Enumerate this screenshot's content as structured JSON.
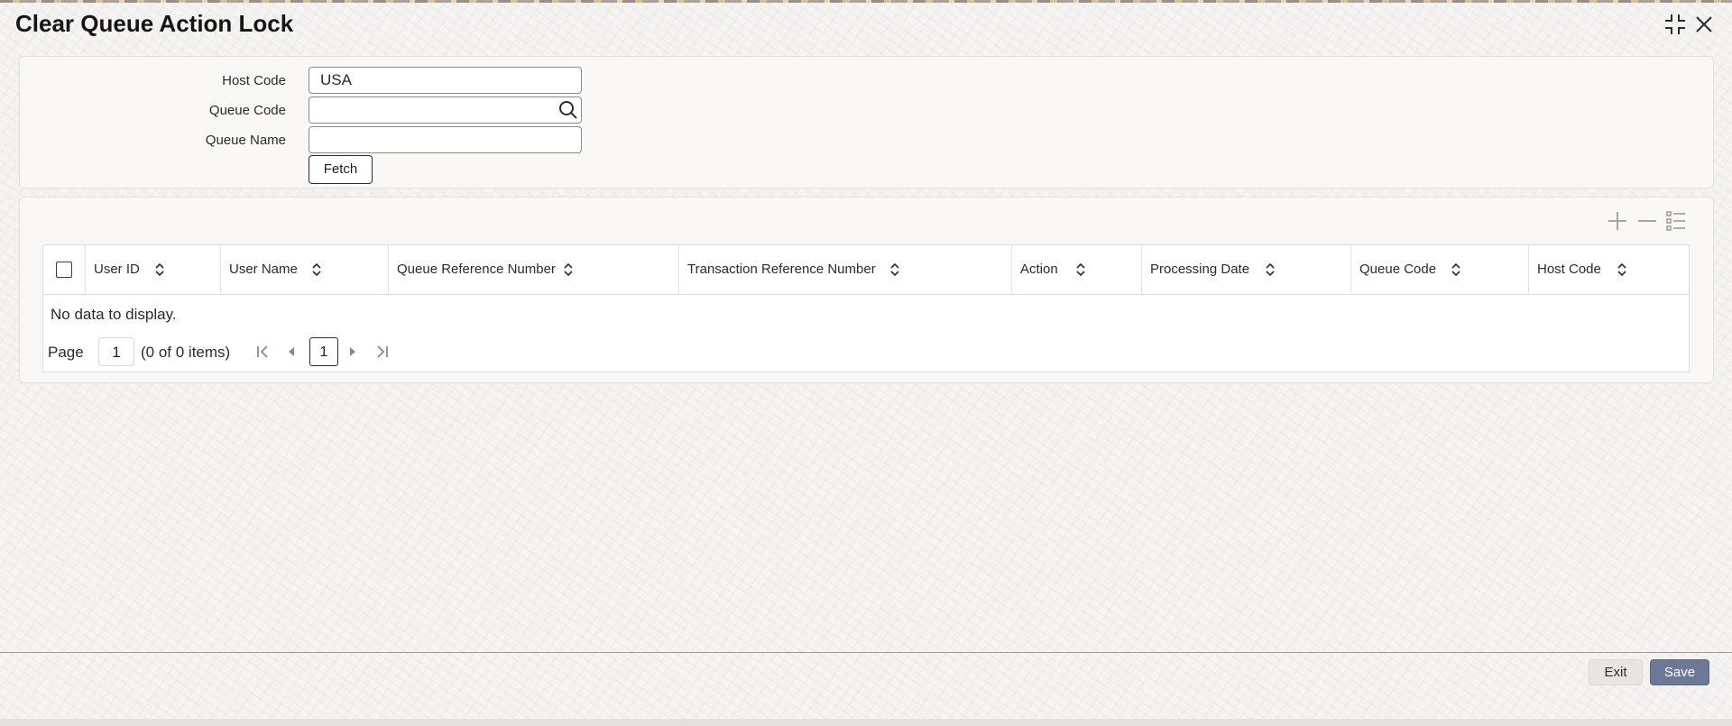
{
  "window": {
    "title": "Clear Queue Action Lock",
    "minimize_icon": "collapse-icon",
    "close_icon": "close-icon"
  },
  "search_form": {
    "host_code": {
      "label": "Host Code",
      "value": "USA"
    },
    "queue_code": {
      "label": "Queue Code",
      "value": "",
      "icon": "search-icon"
    },
    "queue_name": {
      "label": "Queue Name",
      "value": ""
    },
    "fetch_label": "Fetch"
  },
  "grid": {
    "toolbar_icons": [
      "plus-icon",
      "minus-icon",
      "list-icon"
    ],
    "columns": [
      "User ID",
      "User Name",
      "Queue Reference Number",
      "Transaction Reference Number",
      "Action",
      "Processing Date",
      "Queue Code",
      "Host Code"
    ],
    "empty_message": "No data to display.",
    "pagination": {
      "page_label": "Page",
      "page_value": "1",
      "items_summary": "(0 of 0 items)",
      "current_page": "1"
    }
  },
  "footer": {
    "exit_label": "Exit",
    "save_label": "Save"
  },
  "colors": {
    "primary_button": "#6c7896",
    "secondary_button": "#e7e5e2"
  }
}
